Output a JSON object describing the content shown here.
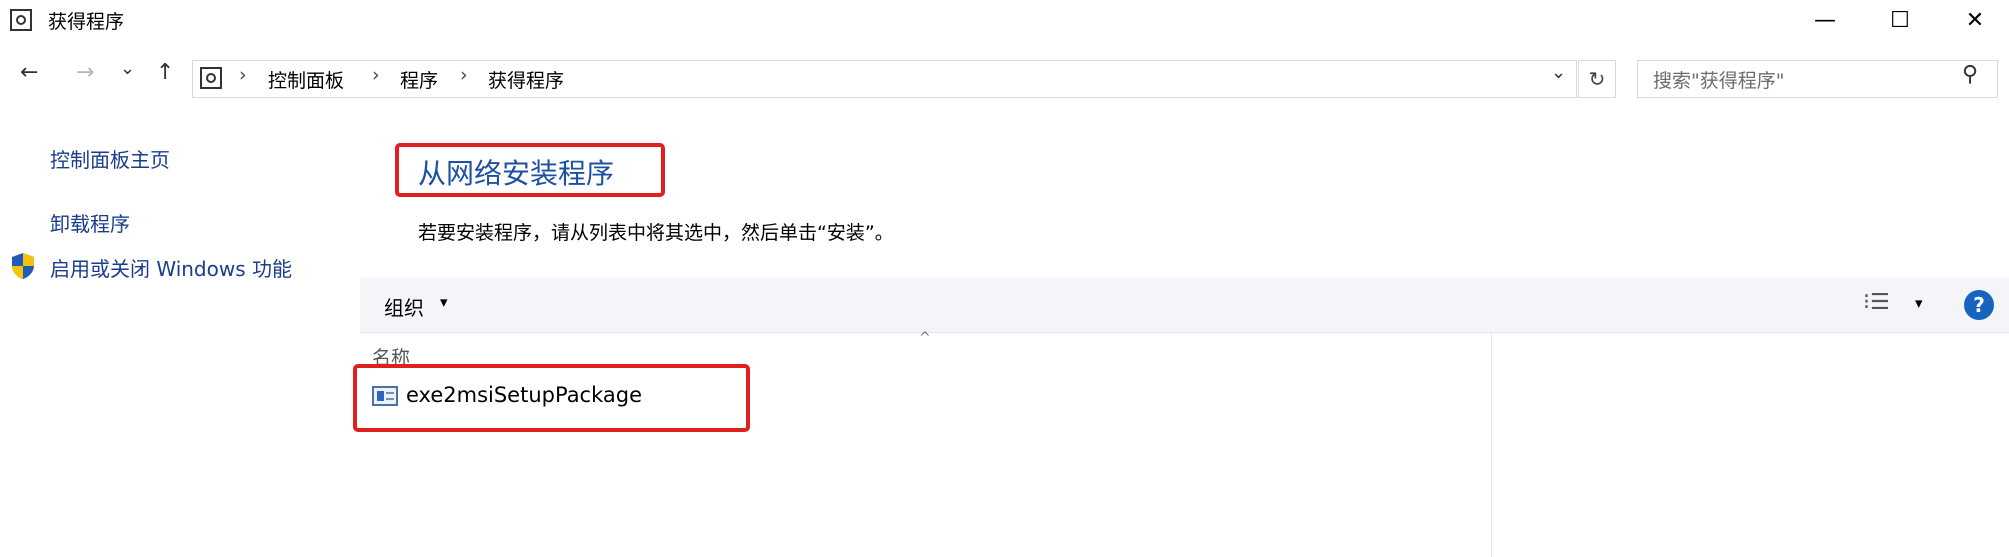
{
  "window": {
    "title": "获得程序",
    "controls": {
      "minimize": "—",
      "maximize": "☐",
      "close": "✕"
    }
  },
  "nav": {
    "back": "←",
    "forward": "→",
    "recent": "⌄",
    "up": "↑",
    "breadcrumb": [
      "控制面板",
      "程序",
      "获得程序"
    ],
    "separator": "›",
    "dropdown": "⌄",
    "refresh": "↻"
  },
  "search": {
    "placeholder": "搜索\"获得程序\"",
    "icon": "⚲"
  },
  "sidebar": {
    "items": [
      {
        "label": "控制面板主页"
      },
      {
        "label": "卸载程序"
      },
      {
        "label": "启用或关闭 Windows 功能",
        "icon": "shield-icon"
      }
    ]
  },
  "main": {
    "heading": "从网络安装程序",
    "instruction": "若要安装程序，请从列表中将其选中，然后单击“安装”。",
    "toolbar": {
      "organize_label": "组织",
      "organize_caret": "▾",
      "view_icon": "⁝☰",
      "view_caret": "▾",
      "help_label": "?"
    },
    "list": {
      "sort_indicator": "^",
      "column_name": "名称",
      "rows": [
        {
          "name": "exe2msiSetupPackage"
        }
      ]
    }
  },
  "colors": {
    "link": "#1a3e8c",
    "heading": "#1e50a2",
    "highlight_border": "#e02020",
    "help_badge": "#1565c0"
  }
}
